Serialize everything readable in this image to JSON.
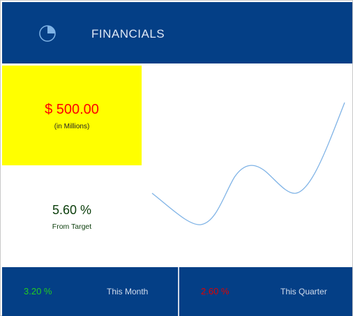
{
  "header": {
    "title": "FINANCIALS",
    "icon": "pie-chart-icon"
  },
  "kpi": {
    "value": "$ 500.00",
    "unit": "(in Millions)"
  },
  "target": {
    "percent": "5.60 %",
    "label": "From Target"
  },
  "footer": {
    "month": {
      "value": "3.20 %",
      "label": "This Month"
    },
    "quarter": {
      "value": "2.60 %",
      "label": "This Quarter"
    }
  },
  "colors": {
    "header_bg": "#043f86",
    "kpi_bg": "#ffff00",
    "kpi_value": "#ff0000",
    "month_value": "#22cc22",
    "quarter_value": "#e00000",
    "sparkline": "#7fb3e6"
  }
}
